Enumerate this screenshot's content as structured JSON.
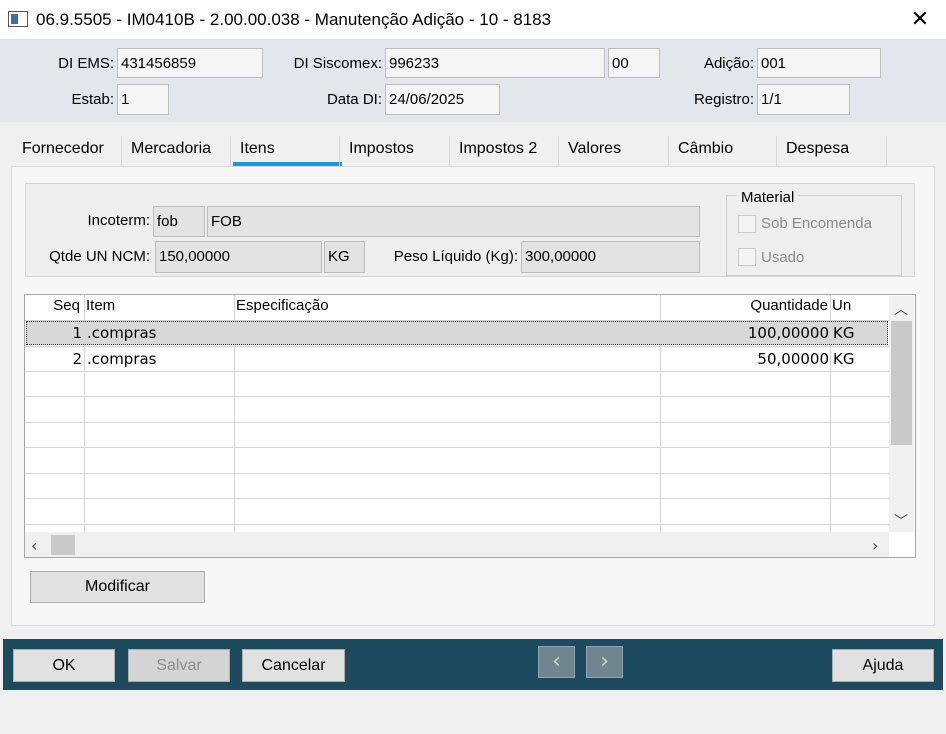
{
  "window": {
    "title": "06.9.5505 - IM0410B - 2.00.00.038 - Manutenção Adição - 10 - 8183",
    "close_glyph": "✕"
  },
  "header": {
    "di_ems_label": "DI EMS:",
    "di_ems_value": "431456859",
    "di_siscomex_label": "DI Siscomex:",
    "di_siscomex_value": "996233",
    "di_siscomex_suffix": "00",
    "adicao_label": "Adição:",
    "adicao_value": "001",
    "estab_label": "Estab:",
    "estab_value": "1",
    "data_di_label": "Data DI:",
    "data_di_value": "24/06/2025",
    "registro_label": "Registro:",
    "registro_value": "1/1"
  },
  "tabs": [
    {
      "label": "Fornecedor"
    },
    {
      "label": "Mercadoria"
    },
    {
      "label": "Itens",
      "active": true
    },
    {
      "label": "Impostos"
    },
    {
      "label": "Impostos 2"
    },
    {
      "label": "Valores"
    },
    {
      "label": "Câmbio"
    },
    {
      "label": "Despesa"
    }
  ],
  "itens": {
    "incoterm_label": "Incoterm:",
    "incoterm_code": "fob",
    "incoterm_desc": "FOB",
    "qtde_label": "Qtde UN NCM:",
    "qtde_value": "150,00000",
    "qtde_unit": "KG",
    "peso_label": "Peso Líquido (Kg):",
    "peso_value": "300,00000",
    "material_group": "Material",
    "sob_encomenda_label": "Sob Encomenda",
    "usado_label": "Usado"
  },
  "grid": {
    "columns": [
      "Seq",
      "Item",
      "Especificação",
      "Quantidade",
      "Un"
    ],
    "rows": [
      {
        "seq": "1",
        "item": ".compras",
        "spec": "",
        "qty": "100,00000",
        "un": "KG"
      },
      {
        "seq": "2",
        "item": ".compras",
        "spec": "",
        "qty": "50,00000",
        "un": "KG"
      }
    ]
  },
  "modify_button": "Modificar",
  "footer": {
    "ok": "OK",
    "salvar": "Salvar",
    "cancelar": "Cancelar",
    "ajuda": "Ajuda",
    "prev_glyph": "‹",
    "next_glyph": "›"
  }
}
